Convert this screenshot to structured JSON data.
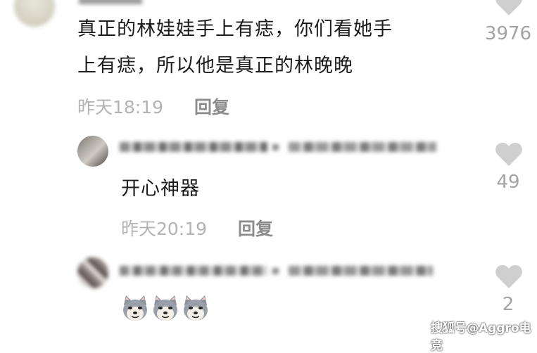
{
  "comments": [
    {
      "text_line1": "真正的林娃娃手上有痣，你们看她手",
      "text_line2": "上有痣，所以他是真正的林晚晚",
      "time": "昨天18:19",
      "reply_label": "回复",
      "like_count": "3976"
    },
    {
      "text": "开心神器",
      "time": "昨天20:19",
      "reply_label": "回复",
      "like_count": "49"
    },
    {
      "emojis": [
        "doge-icon",
        "doge-icon",
        "doge-icon"
      ],
      "like_count": "2"
    }
  ],
  "watermark": "搜狐号@Aggro电竞",
  "colors": {
    "text": "#1c1c1c",
    "meta": "#b3b3b3",
    "reply": "#8c8c8c",
    "heart": "#cfcfcf"
  }
}
